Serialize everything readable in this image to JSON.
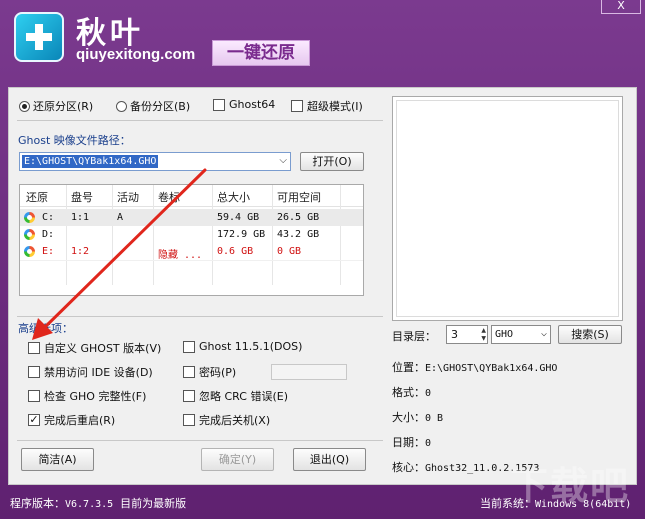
{
  "header": {
    "brand_cn": "秋叶",
    "brand_url": "qiuyexitong.com",
    "tagline": "一键还原",
    "close_label": "X"
  },
  "mode": {
    "restore_label": "还原分区(R)",
    "backup_label": "备份分区(B)",
    "ghost64_label": "Ghost64",
    "super_label": "超级模式(I)",
    "selected": "restore"
  },
  "image_path": {
    "label": "Ghost 映像文件路径：",
    "value": "E:\\GHOST\\QYBak1x64.GHO",
    "open_button": "打开(O)"
  },
  "partitions": {
    "columns": [
      "还原",
      "盘号",
      "活动",
      "卷标",
      "总大小",
      "可用空间"
    ],
    "rows": [
      {
        "drive": "C:",
        "disk": "1:1",
        "active": "A",
        "label": "",
        "total": "59.4 GB",
        "free": "26.5 GB",
        "highlight": false,
        "selected": true
      },
      {
        "drive": "D:",
        "disk": "",
        "active": "",
        "label": "",
        "total": "172.9 GB",
        "free": "43.2 GB",
        "highlight": false,
        "selected": false
      },
      {
        "drive": "E:",
        "disk": "1:2",
        "active": "",
        "label": "隐藏 ...",
        "total": "0.6 GB",
        "free": "0 GB",
        "highlight": true,
        "selected": false
      }
    ]
  },
  "advanced": {
    "label": "高级选项：",
    "custom_ghost": "自定义 GHOST 版本(V)",
    "ghost_version": "Ghost 11.5.1(DOS)",
    "no_ide": "禁用访问 IDE 设备(D)",
    "password": "密码(P)",
    "check_gho": "检查 GHO 完整性(F)",
    "ignore_crc": "忽略 CRC 错误(E)",
    "reboot": "完成后重启(R)",
    "shutdown": "完成后关机(X)",
    "reboot_checked": true
  },
  "buttons": {
    "advanced": "简洁(A)",
    "confirm": "确定(Y)",
    "exit": "退出(Q)"
  },
  "right": {
    "dir_level_label": "目录层：",
    "dir_level_value": "3",
    "ext_value": "GHO",
    "search_button": "搜索(S)",
    "location_label": "位置：",
    "location_value": "E:\\GHOST\\QYBak1x64.GHO",
    "format_label": "格式：",
    "format_value": "0",
    "size_label": "大小：",
    "size_value": "0 B",
    "date_label": "日期：",
    "date_value": "0",
    "core_label": "核心：",
    "core_value": "Ghost32_11.0.2.1573"
  },
  "status": {
    "version_label": "程序版本：",
    "version_value": "V6.7.3.5",
    "update_text": "目前为最新版",
    "system_label": "当前系统：",
    "system_value": "Windows 8(64bit)"
  },
  "watermark": "下载吧",
  "colors": {
    "frame": "#6a2a7c",
    "panel": "#f0f0f0",
    "section_label": "#1a3f8c",
    "highlight_row": "#d01010",
    "arrow": "#e0261c"
  }
}
